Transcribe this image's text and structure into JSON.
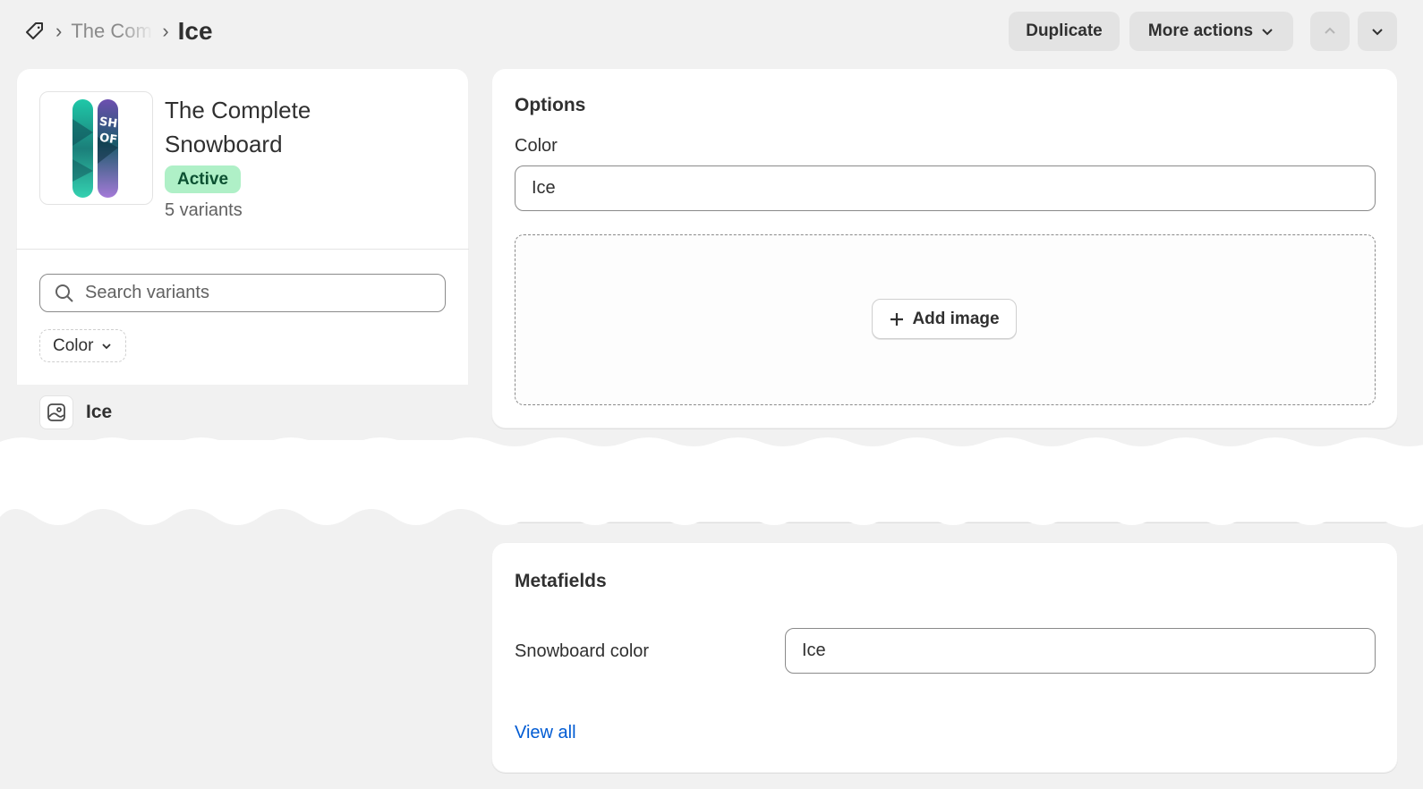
{
  "breadcrumb": {
    "icon": "tag-icon",
    "parent": "The Complete Snowboard",
    "current": "Ice"
  },
  "header": {
    "duplicate_label": "Duplicate",
    "more_actions_label": "More actions"
  },
  "product": {
    "title": "The Complete Snowboard",
    "status": "Active",
    "variant_count": "5 variants"
  },
  "variants": {
    "search_placeholder": "Search variants",
    "filter_label": "Color",
    "items": [
      {
        "label": "Ice"
      }
    ]
  },
  "options": {
    "heading": "Options",
    "field_label": "Color",
    "field_value": "Ice",
    "add_image_label": "Add image"
  },
  "metafields": {
    "heading": "Metafields",
    "rows": [
      {
        "label": "Snowboard color",
        "value": "Ice"
      }
    ],
    "view_all_label": "View all"
  },
  "colors": {
    "background": "#f1f1f1",
    "badge_bg": "#aff0c7",
    "badge_text": "#0c5132",
    "link": "#005bd3"
  }
}
